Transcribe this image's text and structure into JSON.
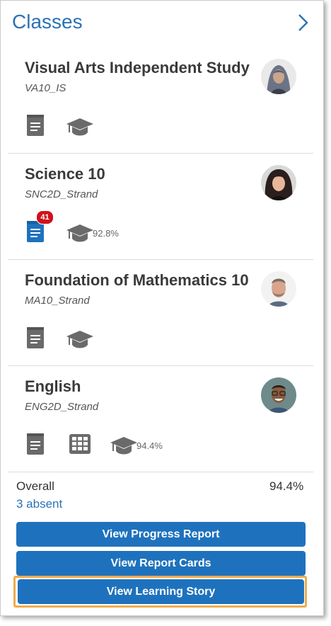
{
  "header": {
    "title": "Classes"
  },
  "classes": [
    {
      "name": "Visual Arts Independent Study",
      "code": "VA10_IS"
    },
    {
      "name": "Science 10",
      "code": "SNC2D_Strand",
      "badge": "41",
      "grade": "92.8%"
    },
    {
      "name": "Foundation of Mathematics 10",
      "code": "MA10_Strand"
    },
    {
      "name": "English",
      "code": "ENG2D_Strand",
      "grade": "94.4%"
    }
  ],
  "summary": {
    "label": "Overall",
    "value": "94.4%",
    "absent": "3 absent"
  },
  "buttons": {
    "progress": "View Progress Report",
    "report_cards": "View Report Cards",
    "learning_story": "View Learning Story"
  },
  "colors": {
    "accent": "#2a72b5",
    "button": "#1e72bd",
    "badge": "#d0111b",
    "highlight": "#f0ab4a",
    "icon_gray": "#6a6a6a"
  },
  "icons": [
    "chevron-right-icon",
    "document-icon",
    "graduation-cap-icon",
    "grid-icon",
    "avatar"
  ]
}
